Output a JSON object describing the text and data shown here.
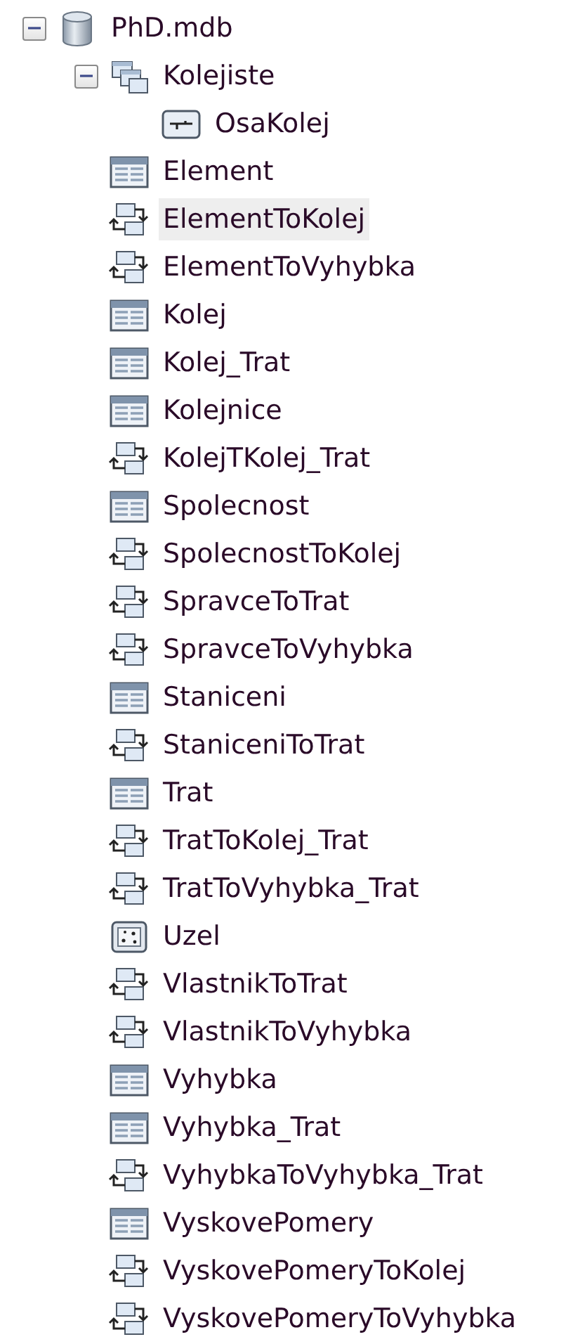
{
  "tree": [
    {
      "name": "PhD.mdb",
      "kind": "database",
      "expanded": true,
      "selected": false,
      "children": [
        {
          "name": "Kolejiste",
          "kind": "dataset",
          "expanded": true,
          "selected": false,
          "children": [
            {
              "name": "OsaKolej",
              "kind": "line",
              "selected": false
            }
          ]
        },
        {
          "name": "Element",
          "kind": "table",
          "selected": false
        },
        {
          "name": "ElementToKolej",
          "kind": "relationship",
          "selected": true
        },
        {
          "name": "ElementToVyhybka",
          "kind": "relationship",
          "selected": false
        },
        {
          "name": "Kolej",
          "kind": "table",
          "selected": false
        },
        {
          "name": "Kolej_Trat",
          "kind": "table",
          "selected": false
        },
        {
          "name": "Kolejnice",
          "kind": "table",
          "selected": false
        },
        {
          "name": "KolejTKolej_Trat",
          "kind": "relationship",
          "selected": false
        },
        {
          "name": "Spolecnost",
          "kind": "table",
          "selected": false
        },
        {
          "name": "SpolecnostToKolej",
          "kind": "relationship",
          "selected": false
        },
        {
          "name": "SpravceToTrat",
          "kind": "relationship",
          "selected": false
        },
        {
          "name": "SpravceToVyhybka",
          "kind": "relationship",
          "selected": false
        },
        {
          "name": "Staniceni",
          "kind": "table",
          "selected": false
        },
        {
          "name": "StaniceniToTrat",
          "kind": "relationship",
          "selected": false
        },
        {
          "name": "Trat",
          "kind": "table",
          "selected": false
        },
        {
          "name": "TratToKolej_Trat",
          "kind": "relationship",
          "selected": false
        },
        {
          "name": "TratToVyhybka_Trat",
          "kind": "relationship",
          "selected": false
        },
        {
          "name": "Uzel",
          "kind": "point",
          "selected": false
        },
        {
          "name": "VlastnikToTrat",
          "kind": "relationship",
          "selected": false
        },
        {
          "name": "VlastnikToVyhybka",
          "kind": "relationship",
          "selected": false
        },
        {
          "name": "Vyhybka",
          "kind": "table",
          "selected": false
        },
        {
          "name": "Vyhybka_Trat",
          "kind": "table",
          "selected": false
        },
        {
          "name": "VyhybkaToVyhybka_Trat",
          "kind": "relationship",
          "selected": false
        },
        {
          "name": "VyskovePomery",
          "kind": "table",
          "selected": false
        },
        {
          "name": "VyskovePomeryToKolej",
          "kind": "relationship",
          "selected": false
        },
        {
          "name": "VyskovePomeryToVyhybka",
          "kind": "relationship",
          "selected": false
        }
      ]
    }
  ]
}
